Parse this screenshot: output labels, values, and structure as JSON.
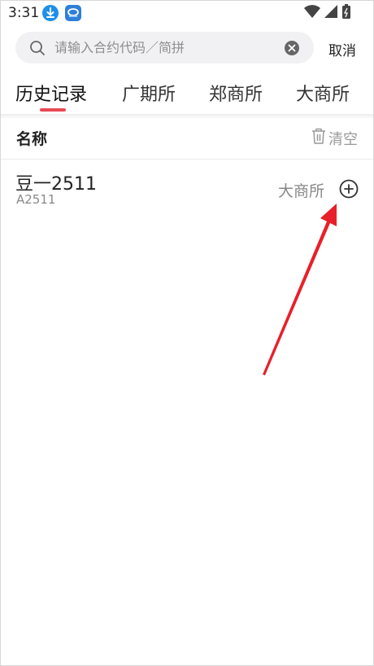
{
  "status_bar": {
    "time": "3:31",
    "icons": [
      "download-icon",
      "app-icon",
      "wifi-icon",
      "signal-icon",
      "battery-icon"
    ]
  },
  "search": {
    "placeholder": "请输入合约代码／简拼",
    "value": "",
    "cancel_label": "取消"
  },
  "tabs": [
    {
      "label": "历史记录",
      "active": true
    },
    {
      "label": "广期所",
      "active": false
    },
    {
      "label": "郑商所",
      "active": false
    },
    {
      "label": "大商所",
      "active": false
    }
  ],
  "list_header": {
    "name_label": "名称",
    "clear_label": "清空"
  },
  "history_items": [
    {
      "name": "豆一2511",
      "code": "A2511",
      "exchange": "大商所",
      "action_icon": "add-circle-icon"
    }
  ],
  "colors": {
    "accent": "#e84a55",
    "annotation_arrow": "#e8202a"
  }
}
